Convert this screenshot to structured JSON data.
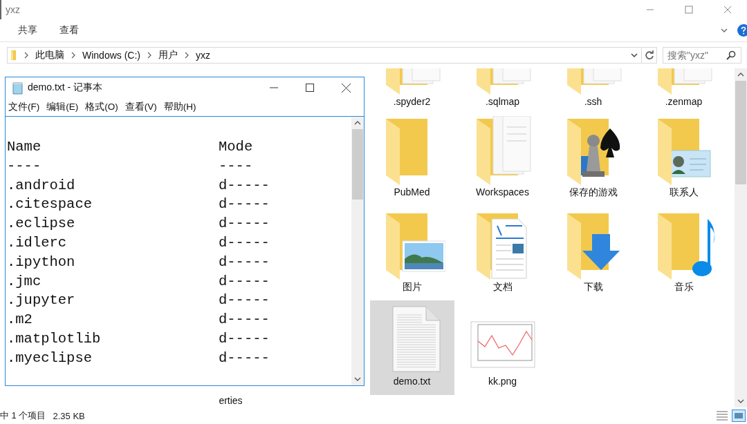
{
  "explorer": {
    "title": "yxz",
    "ribbon_tabs": [
      "共享",
      "查看"
    ],
    "breadcrumbs": [
      "此电脑",
      "Windows (C:)",
      "用户",
      "yxz"
    ],
    "search": {
      "placeholder": "搜索\"yxz\""
    },
    "rows": [
      [
        {
          "kind": "covered"
        },
        {
          "kind": "covered"
        },
        {
          "kind": "covered"
        },
        {
          "kind": "covered"
        },
        {
          "kind": "folder-docs",
          "label": ".spyder2",
          "selected": false
        },
        {
          "kind": "folder-docs",
          "label": ".sqlmap",
          "selected": false
        },
        {
          "kind": "folder-docs",
          "label": ".ssh",
          "selected": false
        },
        {
          "kind": "folder-docs",
          "label": ".zenmap",
          "selected": false
        }
      ],
      [
        {
          "kind": "covered"
        },
        {
          "kind": "covered"
        },
        {
          "kind": "covered"
        },
        {
          "kind": "covered"
        },
        {
          "kind": "folder",
          "label": "PubMed",
          "selected": false
        },
        {
          "kind": "folder-docs",
          "label": "Workspaces",
          "selected": false
        },
        {
          "kind": "folder-games",
          "label": "保存的游戏",
          "selected": false
        },
        {
          "kind": "folder-contacts",
          "label": "联系人",
          "selected": false
        }
      ],
      [
        {
          "kind": "covered"
        },
        {
          "kind": "covered"
        },
        {
          "kind": "covered"
        },
        {
          "kind": "covered"
        },
        {
          "kind": "folder-pictures",
          "label": "图片",
          "selected": false
        },
        {
          "kind": "folder-documents",
          "label": "文档",
          "selected": false
        },
        {
          "kind": "folder-downloads",
          "label": "下载",
          "selected": false
        },
        {
          "kind": "folder-music",
          "label": "音乐",
          "selected": false
        }
      ],
      [
        {
          "kind": "covered"
        },
        {
          "kind": "covered"
        },
        {
          "kind": "covered",
          "label": "erties"
        },
        {
          "kind": "covered"
        },
        {
          "kind": "text-file",
          "label": "demo.txt",
          "selected": true
        },
        {
          "kind": "image-file",
          "label": "kk.png",
          "selected": false
        }
      ]
    ],
    "status": {
      "selection": "中 1 个项目",
      "size": "2.35 KB"
    }
  },
  "notepad": {
    "title": "demo.txt - 记事本",
    "menu": [
      "文件(F)",
      "编辑(E)",
      "格式(O)",
      "查看(V)",
      "帮助(H)"
    ],
    "header": [
      "Name",
      "Mode"
    ],
    "rule": [
      "----",
      "----"
    ],
    "entries": [
      {
        "name": ".android",
        "mode": "d-----"
      },
      {
        "name": ".citespace",
        "mode": "d-----"
      },
      {
        "name": ".eclipse",
        "mode": "d-----"
      },
      {
        "name": ".idlerc",
        "mode": "d-----"
      },
      {
        "name": ".ipython",
        "mode": "d-----"
      },
      {
        "name": ".jmc",
        "mode": "d-----"
      },
      {
        "name": ".jupyter",
        "mode": "d-----"
      },
      {
        "name": ".m2",
        "mode": "d-----"
      },
      {
        "name": ".matplotlib",
        "mode": "d-----"
      },
      {
        "name": ".myeclipse",
        "mode": "d-----"
      }
    ]
  }
}
